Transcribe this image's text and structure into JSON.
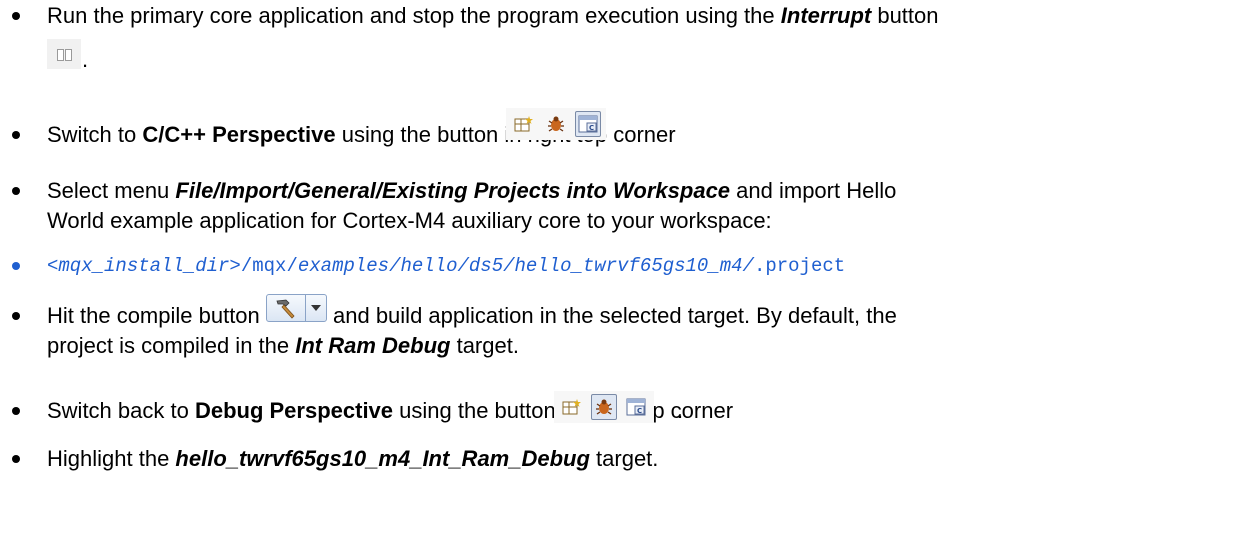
{
  "items": [
    {
      "line1_pre": "Run the primary core application and stop the program execution using the ",
      "line1_em": "Interrupt",
      "line1_post": " button",
      "line2_post": "."
    },
    {
      "pre": "Switch to ",
      "bold": "C/C++ Perspective",
      "post": " using the button in right top corner",
      "end": "."
    },
    {
      "pre": "Select menu ",
      "em": "File/Import/General/Existing Projects into Workspace",
      "post": " and import Hello",
      "line2": "World example application for Cortex-M4 auxiliary core to your workspace:"
    },
    {
      "code_italic_1": "<mqx_install_dir>",
      "code_plain_1": "/mqx/",
      "code_italic_2": "examples/hello/ds5/hello_twrvf65gs10_m4/",
      "code_plain_2": ".project"
    },
    {
      "pre": "Hit the compile button",
      "post": " and build application in the selected target. By default, the",
      "line2_pre": "project is compiled in the ",
      "line2_em": "Int Ram Debug",
      "line2_post": " target."
    },
    {
      "pre": "Switch back to ",
      "bold": "Debug Perspective",
      "post": " using the button in right top corner",
      "end": "."
    },
    {
      "pre": "Highlight the ",
      "em": "hello_twrvf65gs10_m4_Int_Ram_Debug",
      "post": " target."
    }
  ],
  "icons": {
    "interrupt": "pause-icon",
    "perspective_open": "open-perspective-icon",
    "debug_perspective": "debug-bug-icon",
    "cpp_perspective": "c-cpp-perspective-icon",
    "build": "hammer-icon",
    "dropdown": "dropdown-arrow-icon"
  }
}
